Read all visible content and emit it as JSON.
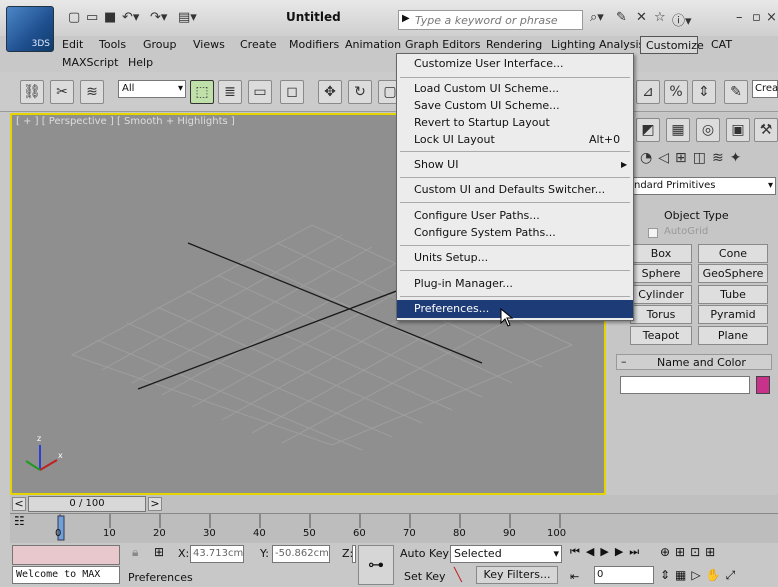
{
  "app": {
    "title": "Untitled",
    "logo_text": "3DS"
  },
  "search": {
    "placeholder": "Type a keyword or phrase"
  },
  "menu": {
    "row1": [
      "Edit",
      "Tools",
      "Group",
      "Views",
      "Create",
      "Modifiers",
      "Animation",
      "Graph Editors",
      "Rendering",
      "Lighting Analysis",
      "Customize",
      "CAT"
    ],
    "row2": [
      "MAXScript",
      "Help"
    ]
  },
  "toolbar": {
    "selection_filter": "All",
    "create_set": "Creat"
  },
  "viewport": {
    "label": "[ + ] [ Perspective ] [ Smooth + Highlights ]"
  },
  "customize_menu": {
    "items": [
      {
        "label": "Customize User Interface...",
        "shortcut": ""
      },
      {
        "label": "Load Custom UI Scheme...",
        "shortcut": ""
      },
      {
        "label": "Save Custom UI Scheme...",
        "shortcut": ""
      },
      {
        "label": "Revert to Startup Layout",
        "shortcut": ""
      },
      {
        "label": "Lock UI Layout",
        "shortcut": "Alt+0"
      },
      {
        "label": "Show UI",
        "shortcut": ""
      },
      {
        "label": "Custom UI and Defaults Switcher...",
        "shortcut": ""
      },
      {
        "label": "Configure User Paths...",
        "shortcut": ""
      },
      {
        "label": "Configure System Paths...",
        "shortcut": ""
      },
      {
        "label": "Units Setup...",
        "shortcut": ""
      },
      {
        "label": "Plug-in Manager...",
        "shortcut": ""
      },
      {
        "label": "Preferences...",
        "shortcut": ""
      }
    ]
  },
  "command_panel": {
    "category": "ndard Primitives",
    "rollout_title": "Object Type",
    "autogrid": "AutoGrid",
    "buttons": [
      "Box",
      "Cone",
      "Sphere",
      "GeoSphere",
      "Cylinder",
      "Tube",
      "Torus",
      "Pyramid",
      "Teapot",
      "Plane"
    ],
    "name_color_title": "Name and Color",
    "swatch_color": "#c8328a"
  },
  "timeline": {
    "frame": "0 / 100",
    "ticks": [
      "0",
      "10",
      "20",
      "30",
      "40",
      "50",
      "60",
      "70",
      "80",
      "90",
      "100"
    ]
  },
  "status": {
    "listener": "Welcome to MAX",
    "prompt": "Preferences",
    "x_label": "X:",
    "x_value": "43.713cm",
    "y_label": "Y:",
    "y_value": "-50.862cm",
    "z_label": "Z:",
    "auto_key": "Auto Key",
    "selected": "Selected",
    "set_key": "Set Key",
    "key_filters": "Key Filters...",
    "frame_field": "0"
  }
}
